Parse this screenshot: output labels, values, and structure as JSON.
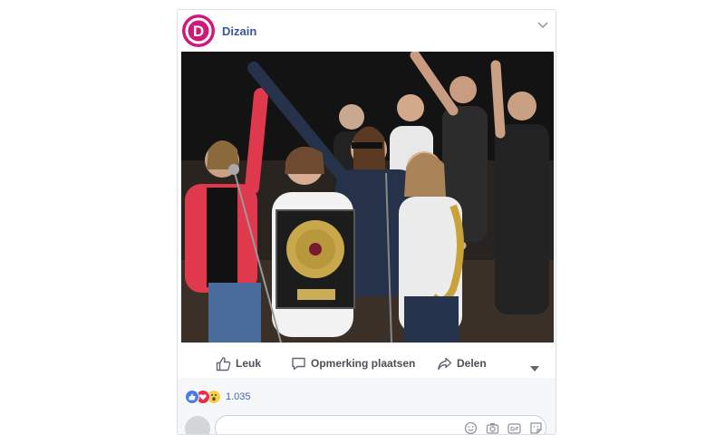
{
  "post": {
    "page_name": "Dizain",
    "logo_letter": "D",
    "photo_alt": "Band members celebrating with a gold record"
  },
  "actions": {
    "like_label": "Leuk",
    "comment_label": "Opmerking plaatsen",
    "share_label": "Delen"
  },
  "reactions": {
    "types": [
      "like",
      "love",
      "wow"
    ],
    "count": "1.035"
  },
  "comment": {
    "placeholder": ""
  },
  "colors": {
    "brand": "#d0177a",
    "link": "#365899",
    "action_text": "#4b4f56",
    "like_blue": "#4a7ce8",
    "love_red": "#f0284a",
    "wow_yellow": "#f7cf44"
  }
}
